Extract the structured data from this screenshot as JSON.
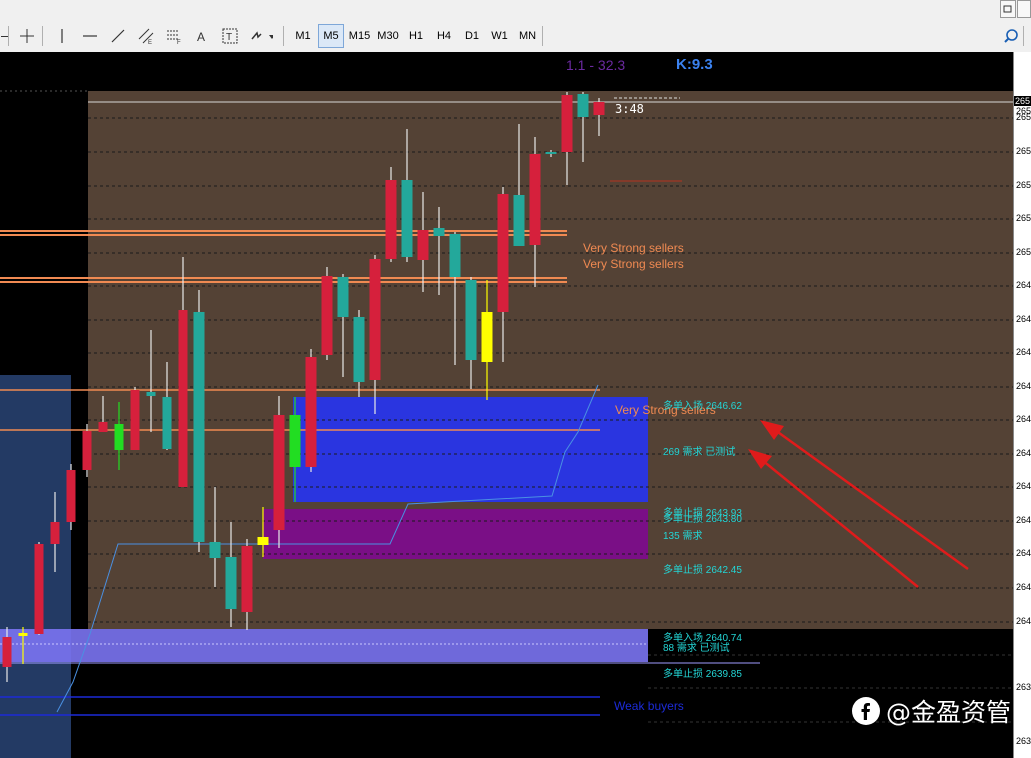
{
  "toolbar": {
    "timeframes": [
      "M1",
      "M5",
      "M15",
      "M30",
      "H1",
      "H4",
      "D1",
      "W1",
      "MN"
    ],
    "active_timeframe": "M5"
  },
  "header": {
    "range_text": "1.1 - 32.3",
    "k_text": "K:9.3",
    "countdown": "3:48"
  },
  "price_axis": {
    "labels": [
      "265",
      "265",
      "265",
      "265",
      "265",
      "265",
      "264",
      "264",
      "264",
      "264",
      "264",
      "264",
      "264",
      "264",
      "264",
      "264",
      "264",
      "263",
      "263"
    ],
    "current_label": "265"
  },
  "zones": {
    "sellers_1": "Very Strong sellers",
    "sellers_2": "Very Strong sellers",
    "sellers_3": "Very Strong sellers",
    "weak_buyers": "Weak buyers"
  },
  "annotations": {
    "entry_1": "多单入场 2646.62",
    "demand_269": "269 需求 已测试",
    "stop_1a": "多单止损 2643.93",
    "stop_1b": "多单止损 2643.80",
    "demand_135": "135 需求",
    "stop_2": "多单止损 2642.45",
    "entry_2": "多单入场 2640.74",
    "demand_88": "88 需求 已测试",
    "stop_3": "多单止损 2639.85"
  },
  "watermark": {
    "text": "@金盈资管"
  },
  "colors": {
    "bull": "#23a89b",
    "bear": "#d6203c",
    "plot_bg": "#544235",
    "demand_blue": "#2a35e0",
    "demand_purple": "#7a0f86",
    "demand_lavender": "#7b74f2",
    "seller_line": "#f08a52",
    "annotation": "#23d5d5"
  }
}
